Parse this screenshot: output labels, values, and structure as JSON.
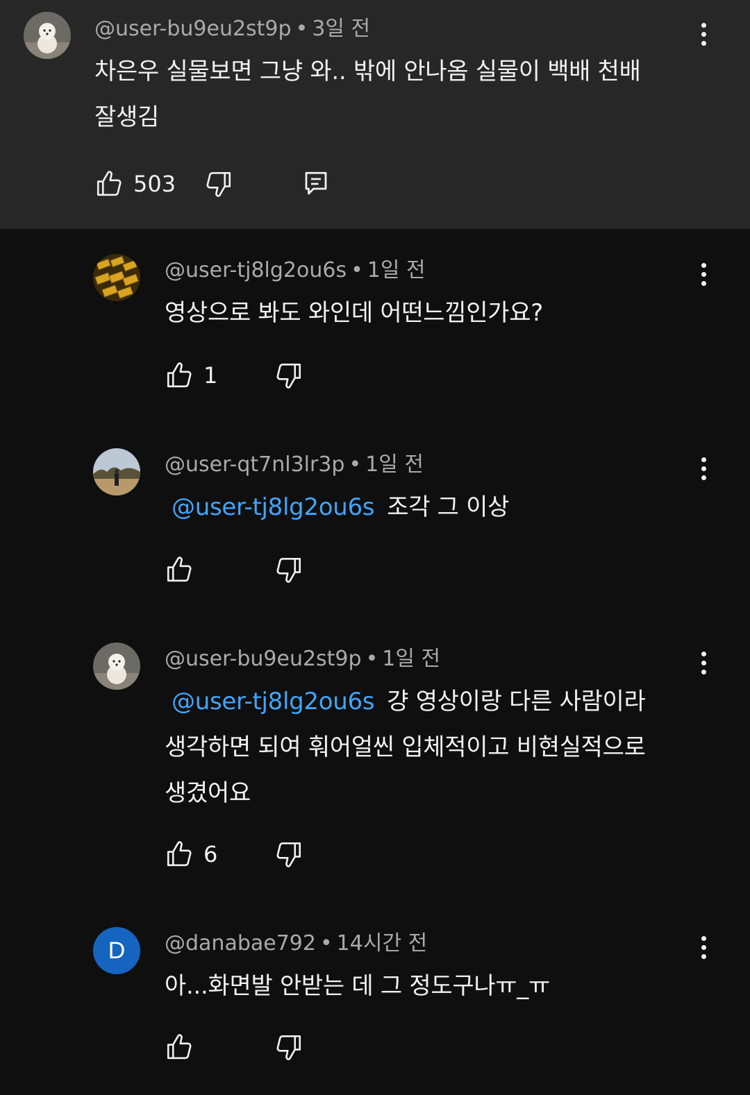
{
  "parent": {
    "author": "@user-bu9eu2st9p",
    "time": "3일 전",
    "text_line1": "차은우 실물보면 그냥 와.. 밖에 안나옴 실물이 백배 천배",
    "text_line2": "잘생김",
    "likes": "503"
  },
  "replies": [
    {
      "author": "@user-tj8lg2ou6s",
      "time": "1일 전",
      "text": "영상으로 봐도 와인데 어떤느낌인가요?",
      "likes": "1"
    },
    {
      "author": "@user-qt7nl3lr3p",
      "time": "1일 전",
      "mention": "@user-tj8lg2ou6s",
      "text": "조각 그 이상",
      "likes": ""
    },
    {
      "author": "@user-bu9eu2st9p",
      "time": "1일 전",
      "mention": "@user-tj8lg2ou6s",
      "text_line1": "걍 영상이랑 다른 사람이라",
      "text_line2": "생각하면 되여 훠어얼씬 입체적이고 비현실적으로",
      "text_line3": "생겼어요",
      "likes": "6"
    },
    {
      "author": "@danabae792",
      "time": "14시간 전",
      "avatar_letter": "D",
      "text": "아...화면발 안받는 데 그 정도구나ㅠ_ㅠ",
      "likes": ""
    }
  ],
  "icons": {
    "like": "thumbs-up-icon",
    "dislike": "thumbs-down-icon",
    "reply": "reply-comment-icon",
    "more": "more-vertical-icon"
  },
  "colors": {
    "background": "#0f0f0f",
    "highlight": "#272727",
    "mention": "#3ea6ff",
    "meta": "#aaaaaa"
  }
}
